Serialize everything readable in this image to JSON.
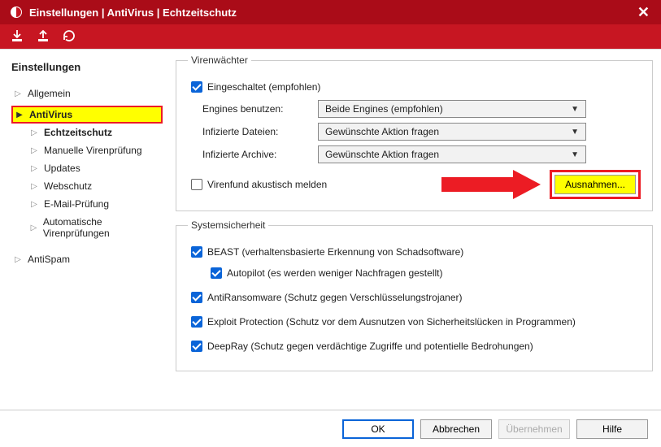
{
  "window": {
    "title": "Einstellungen | AntiVirus | Echtzeitschutz"
  },
  "sidebar": {
    "heading": "Einstellungen",
    "items": [
      {
        "label": "Allgemein",
        "level": 1,
        "expanded": false,
        "bold": false
      },
      {
        "label": "AntiVirus",
        "level": 1,
        "expanded": true,
        "bold": true,
        "highlight": true
      },
      {
        "label": "Echtzeitschutz",
        "level": 2,
        "expanded": false,
        "bold": true
      },
      {
        "label": "Manuelle Virenprüfung",
        "level": 2,
        "expanded": false,
        "bold": false
      },
      {
        "label": "Updates",
        "level": 2,
        "expanded": false,
        "bold": false
      },
      {
        "label": "Webschutz",
        "level": 2,
        "expanded": false,
        "bold": false
      },
      {
        "label": "E-Mail-Prüfung",
        "level": 2,
        "expanded": false,
        "bold": false
      },
      {
        "label": "Automatische Virenprüfungen",
        "level": 2,
        "expanded": false,
        "bold": false
      },
      {
        "label": "AntiSpam",
        "level": 1,
        "expanded": false,
        "bold": false
      }
    ]
  },
  "groups": {
    "virenwachter": {
      "legend": "Virenwächter",
      "enabled_label": "Eingeschaltet (empfohlen)",
      "enabled_checked": true,
      "engines_label": "Engines benutzen:",
      "engines_value": "Beide Engines (empfohlen)",
      "infected_files_label": "Infizierte Dateien:",
      "infected_files_value": "Gewünschte Aktion fragen",
      "infected_archives_label": "Infizierte Archive:",
      "infected_archives_value": "Gewünschte Aktion fragen",
      "acoustic_label": "Virenfund akustisch melden",
      "acoustic_checked": false,
      "exceptions_button": "Ausnahmen..."
    },
    "systemsicherheit": {
      "legend": "Systemsicherheit",
      "beast_label": "BEAST (verhaltensbasierte Erkennung von Schadsoftware)",
      "beast_checked": true,
      "autopilot_label": "Autopilot (es werden weniger Nachfragen gestellt)",
      "autopilot_checked": true,
      "antiransom_label": "AntiRansomware (Schutz gegen Verschlüsselungstrojaner)",
      "antiransom_checked": true,
      "exploit_label": "Exploit Protection (Schutz vor dem Ausnutzen von Sicherheitslücken in Programmen)",
      "exploit_checked": true,
      "deepray_label": "DeepRay (Schutz gegen verdächtige Zugriffe und potentielle Bedrohungen)",
      "deepray_checked": true
    }
  },
  "footer": {
    "ok": "OK",
    "cancel": "Abbrechen",
    "apply": "Übernehmen",
    "help": "Hilfe"
  }
}
